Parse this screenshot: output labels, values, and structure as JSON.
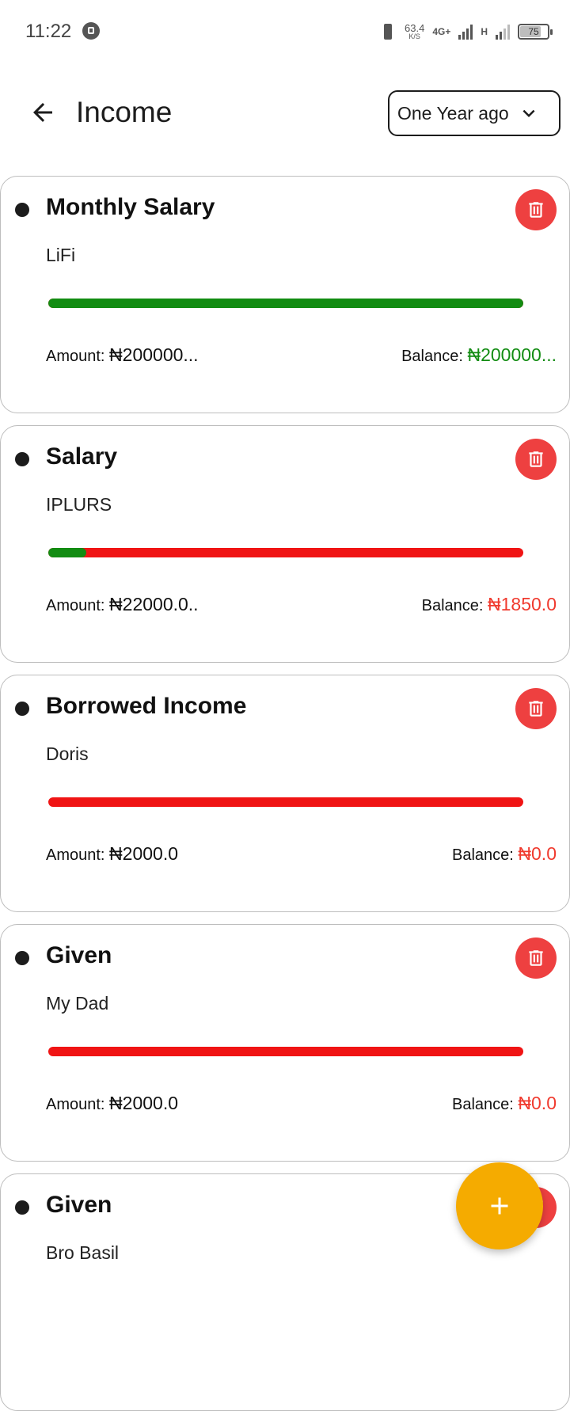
{
  "status_bar": {
    "time": "11:22",
    "net_speed_value": "63.4",
    "net_speed_unit": "K/S",
    "network_type": "4G+",
    "network_type_2": "H",
    "battery": "75"
  },
  "header": {
    "title": "Income",
    "period_selected": "One Year ago"
  },
  "colors": {
    "positive": "#128c12",
    "negative": "#f01414",
    "delete": "#ee4040",
    "fab": "#f5ab00"
  },
  "incomes": [
    {
      "title": "Monthly Salary",
      "source": "LiFi",
      "amount_label": "Amount:",
      "amount": "₦200000...",
      "balance_label": "Balance:",
      "balance": "₦200000...",
      "balance_color": "#128c12",
      "progress": 1.0
    },
    {
      "title": "Salary",
      "source": "IPLURS",
      "amount_label": "Amount:",
      "amount": "₦22000.0..",
      "balance_label": "Balance:",
      "balance": "₦1850.0",
      "balance_color": "#f03a2e",
      "progress": 0.08
    },
    {
      "title": "Borrowed Income",
      "source": "Doris",
      "amount_label": "Amount:",
      "amount": "₦2000.0",
      "balance_label": "Balance:",
      "balance": "₦0.0",
      "balance_color": "#f03a2e",
      "progress": 0.0
    },
    {
      "title": "Given",
      "source": "My Dad",
      "amount_label": "Amount:",
      "amount": "₦2000.0",
      "balance_label": "Balance:",
      "balance": "₦0.0",
      "balance_color": "#f03a2e",
      "progress": 0.0
    },
    {
      "title": "Given",
      "source": "Bro Basil",
      "amount_label": "",
      "amount": "",
      "balance_label": "",
      "balance": "",
      "balance_color": "#f03a2e",
      "progress": 0.0
    }
  ]
}
